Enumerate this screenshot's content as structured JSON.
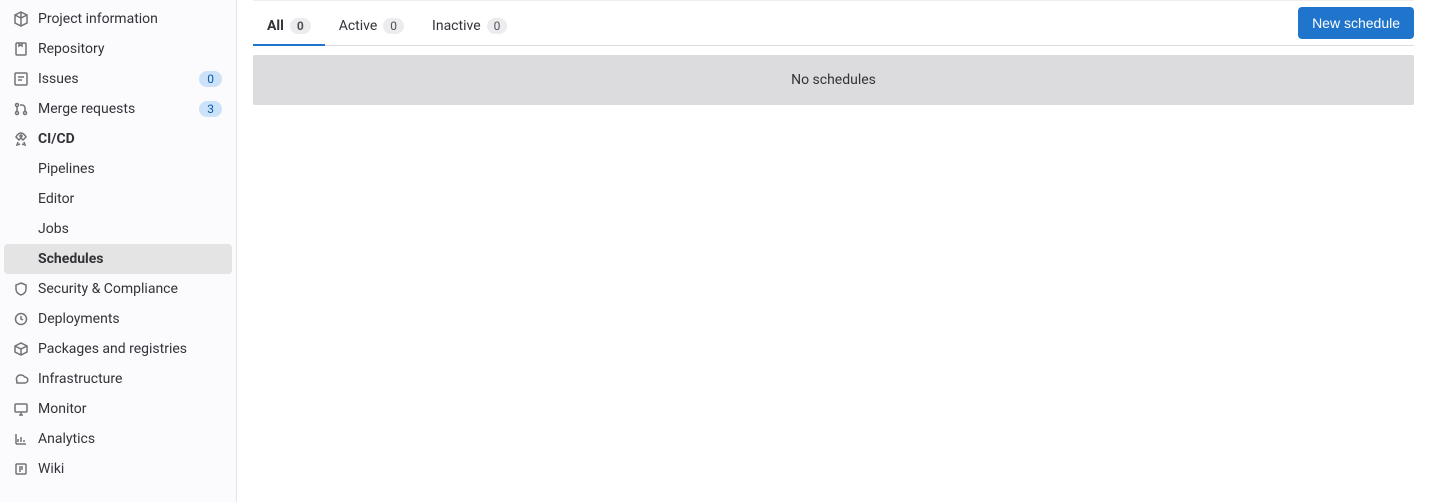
{
  "sidebar": {
    "items": [
      {
        "label": "Project information",
        "icon": "project-info"
      },
      {
        "label": "Repository",
        "icon": "repository"
      },
      {
        "label": "Issues",
        "icon": "issues",
        "badge": "0"
      },
      {
        "label": "Merge requests",
        "icon": "merge-requests",
        "badge": "3"
      },
      {
        "label": "CI/CD",
        "icon": "cicd",
        "active": true,
        "subitems": [
          {
            "label": "Pipelines"
          },
          {
            "label": "Editor"
          },
          {
            "label": "Jobs"
          },
          {
            "label": "Schedules",
            "active": true
          }
        ]
      },
      {
        "label": "Security & Compliance",
        "icon": "security"
      },
      {
        "label": "Deployments",
        "icon": "deployments"
      },
      {
        "label": "Packages and registries",
        "icon": "packages"
      },
      {
        "label": "Infrastructure",
        "icon": "infrastructure"
      },
      {
        "label": "Monitor",
        "icon": "monitor"
      },
      {
        "label": "Analytics",
        "icon": "analytics"
      },
      {
        "label": "Wiki",
        "icon": "wiki"
      }
    ]
  },
  "tabs": [
    {
      "label": "All",
      "count": "0",
      "active": true
    },
    {
      "label": "Active",
      "count": "0"
    },
    {
      "label": "Inactive",
      "count": "0"
    }
  ],
  "new_button": "New schedule",
  "empty_message": "No schedules"
}
